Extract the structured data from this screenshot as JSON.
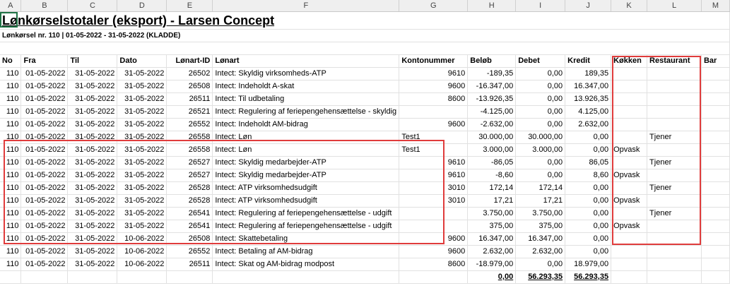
{
  "columns": [
    "A",
    "B",
    "C",
    "D",
    "E",
    "F",
    "G",
    "H",
    "I",
    "J",
    "K",
    "L",
    "M"
  ],
  "title": "Lønkørselstotaler (eksport) -  Larsen Concept",
  "subtitle": "Lønkørsel nr. 110 | 01-05-2022 - 31-05-2022 (KLADDE)",
  "headers": [
    "No",
    "Fra",
    "Til",
    "Dato",
    "Lønart-ID",
    "Lønart",
    "Kontonummer",
    "Beløb",
    "Debet",
    "Kredit",
    "Køkken",
    "Restaurant",
    "Bar"
  ],
  "rows": [
    [
      "110",
      "01-05-2022",
      "31-05-2022",
      "31-05-2022",
      "26502",
      "Intect: Skyldig virksomheds-ATP",
      "9610",
      "-189,35",
      "0,00",
      "189,35",
      "",
      "",
      ""
    ],
    [
      "110",
      "01-05-2022",
      "31-05-2022",
      "31-05-2022",
      "26508",
      "Intect: Indeholdt A-skat",
      "9600",
      "-16.347,00",
      "0,00",
      "16.347,00",
      "",
      "",
      ""
    ],
    [
      "110",
      "01-05-2022",
      "31-05-2022",
      "31-05-2022",
      "26511",
      "Intect: Til udbetaling",
      "8600",
      "-13.926,35",
      "0,00",
      "13.926,35",
      "",
      "",
      ""
    ],
    [
      "110",
      "01-05-2022",
      "31-05-2022",
      "31-05-2022",
      "26521",
      "Intect: Regulering af feriepengehensættelse - skyldig",
      "",
      "-4.125,00",
      "0,00",
      "4.125,00",
      "",
      "",
      ""
    ],
    [
      "110",
      "01-05-2022",
      "31-05-2022",
      "31-05-2022",
      "26552",
      "Intect: Indeholdt AM-bidrag",
      "9600",
      "-2.632,00",
      "0,00",
      "2.632,00",
      "",
      "",
      ""
    ],
    [
      "110",
      "01-05-2022",
      "31-05-2022",
      "31-05-2022",
      "26558",
      "Intect: Løn",
      "Test1",
      "30.000,00",
      "30.000,00",
      "0,00",
      "",
      "Tjener",
      ""
    ],
    [
      "110",
      "01-05-2022",
      "31-05-2022",
      "31-05-2022",
      "26558",
      "Intect: Løn",
      "Test1",
      "3.000,00",
      "3.000,00",
      "0,00",
      "Opvask",
      "",
      ""
    ],
    [
      "110",
      "01-05-2022",
      "31-05-2022",
      "31-05-2022",
      "26527",
      "Intect: Skyldig medarbejder-ATP",
      "9610",
      "-86,05",
      "0,00",
      "86,05",
      "",
      "Tjener",
      ""
    ],
    [
      "110",
      "01-05-2022",
      "31-05-2022",
      "31-05-2022",
      "26527",
      "Intect: Skyldig medarbejder-ATP",
      "9610",
      "-8,60",
      "0,00",
      "8,60",
      "Opvask",
      "",
      ""
    ],
    [
      "110",
      "01-05-2022",
      "31-05-2022",
      "31-05-2022",
      "26528",
      "Intect: ATP virksomhedsudgift",
      "3010",
      "172,14",
      "172,14",
      "0,00",
      "",
      "Tjener",
      ""
    ],
    [
      "110",
      "01-05-2022",
      "31-05-2022",
      "31-05-2022",
      "26528",
      "Intect: ATP virksomhedsudgift",
      "3010",
      "17,21",
      "17,21",
      "0,00",
      "Opvask",
      "",
      ""
    ],
    [
      "110",
      "01-05-2022",
      "31-05-2022",
      "31-05-2022",
      "26541",
      "Intect: Regulering af feriepengehensættelse - udgift",
      "",
      "3.750,00",
      "3.750,00",
      "0,00",
      "",
      "Tjener",
      ""
    ],
    [
      "110",
      "01-05-2022",
      "31-05-2022",
      "31-05-2022",
      "26541",
      "Intect: Regulering af feriepengehensættelse - udgift",
      "",
      "375,00",
      "375,00",
      "0,00",
      "Opvask",
      "",
      ""
    ],
    [
      "110",
      "01-05-2022",
      "31-05-2022",
      "10-06-2022",
      "26508",
      "Intect: Skattebetaling",
      "9600",
      "16.347,00",
      "16.347,00",
      "0,00",
      "",
      "",
      ""
    ],
    [
      "110",
      "01-05-2022",
      "31-05-2022",
      "10-06-2022",
      "26552",
      "Intect: Betaling af AM-bidrag",
      "9600",
      "2.632,00",
      "2.632,00",
      "0,00",
      "",
      "",
      ""
    ],
    [
      "110",
      "01-05-2022",
      "31-05-2022",
      "10-06-2022",
      "26511",
      "Intect: Skat og AM-bidrag modpost",
      "8600",
      "-18.979,00",
      "0,00",
      "18.979,00",
      "",
      "",
      ""
    ]
  ],
  "totals": {
    "belob": "0,00",
    "debet": "56.293,35",
    "kredit": "56.293,35"
  },
  "colors": {
    "highlight_box": "#e03c3c",
    "selection": "#217346"
  }
}
